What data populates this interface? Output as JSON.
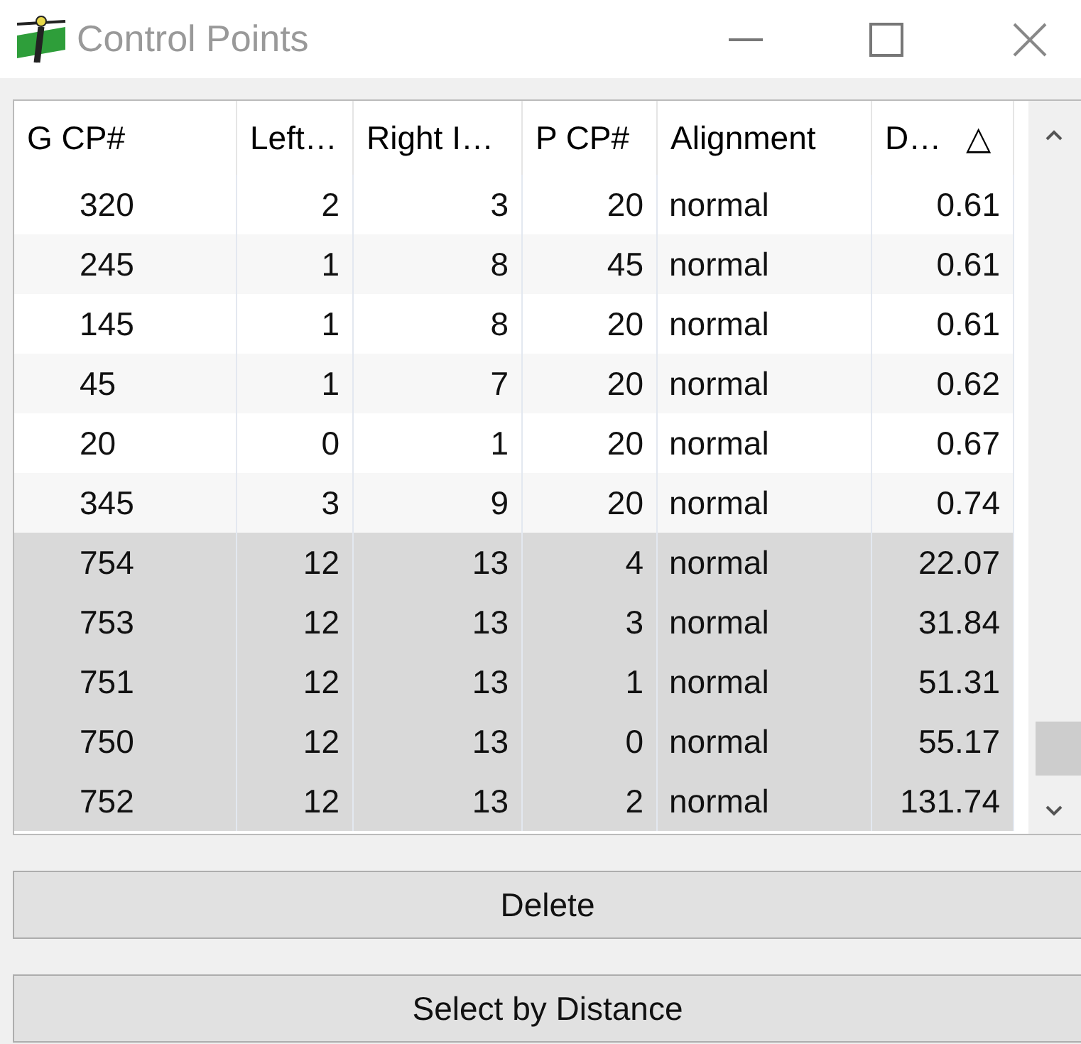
{
  "window": {
    "title": "Control Points"
  },
  "table": {
    "columns": [
      {
        "label": "G CP#",
        "kind": "text"
      },
      {
        "label": "Left…",
        "kind": "number"
      },
      {
        "label": "Right I…",
        "kind": "number"
      },
      {
        "label": "P CP#",
        "kind": "number"
      },
      {
        "label": "Alignment",
        "kind": "text"
      },
      {
        "label": "D…",
        "kind": "number",
        "sort": "△"
      }
    ],
    "rows": [
      {
        "cells": [
          "320",
          "2",
          "3",
          "20",
          "normal",
          "0.61"
        ],
        "selected": false
      },
      {
        "cells": [
          "245",
          "1",
          "8",
          "45",
          "normal",
          "0.61"
        ],
        "selected": false
      },
      {
        "cells": [
          "145",
          "1",
          "8",
          "20",
          "normal",
          "0.61"
        ],
        "selected": false
      },
      {
        "cells": [
          "45",
          "1",
          "7",
          "20",
          "normal",
          "0.62"
        ],
        "selected": false
      },
      {
        "cells": [
          "20",
          "0",
          "1",
          "20",
          "normal",
          "0.67"
        ],
        "selected": false
      },
      {
        "cells": [
          "345",
          "3",
          "9",
          "20",
          "normal",
          "0.74"
        ],
        "selected": false
      },
      {
        "cells": [
          "754",
          "12",
          "13",
          "4",
          "normal",
          "22.07"
        ],
        "selected": true
      },
      {
        "cells": [
          "753",
          "12",
          "13",
          "3",
          "normal",
          "31.84"
        ],
        "selected": true
      },
      {
        "cells": [
          "751",
          "12",
          "13",
          "1",
          "normal",
          "51.31"
        ],
        "selected": true
      },
      {
        "cells": [
          "750",
          "12",
          "13",
          "0",
          "normal",
          "55.17"
        ],
        "selected": true
      },
      {
        "cells": [
          "752",
          "12",
          "13",
          "2",
          "normal",
          "131.74"
        ],
        "selected": true
      }
    ]
  },
  "buttons": [
    "Delete",
    "Select by Distance"
  ]
}
